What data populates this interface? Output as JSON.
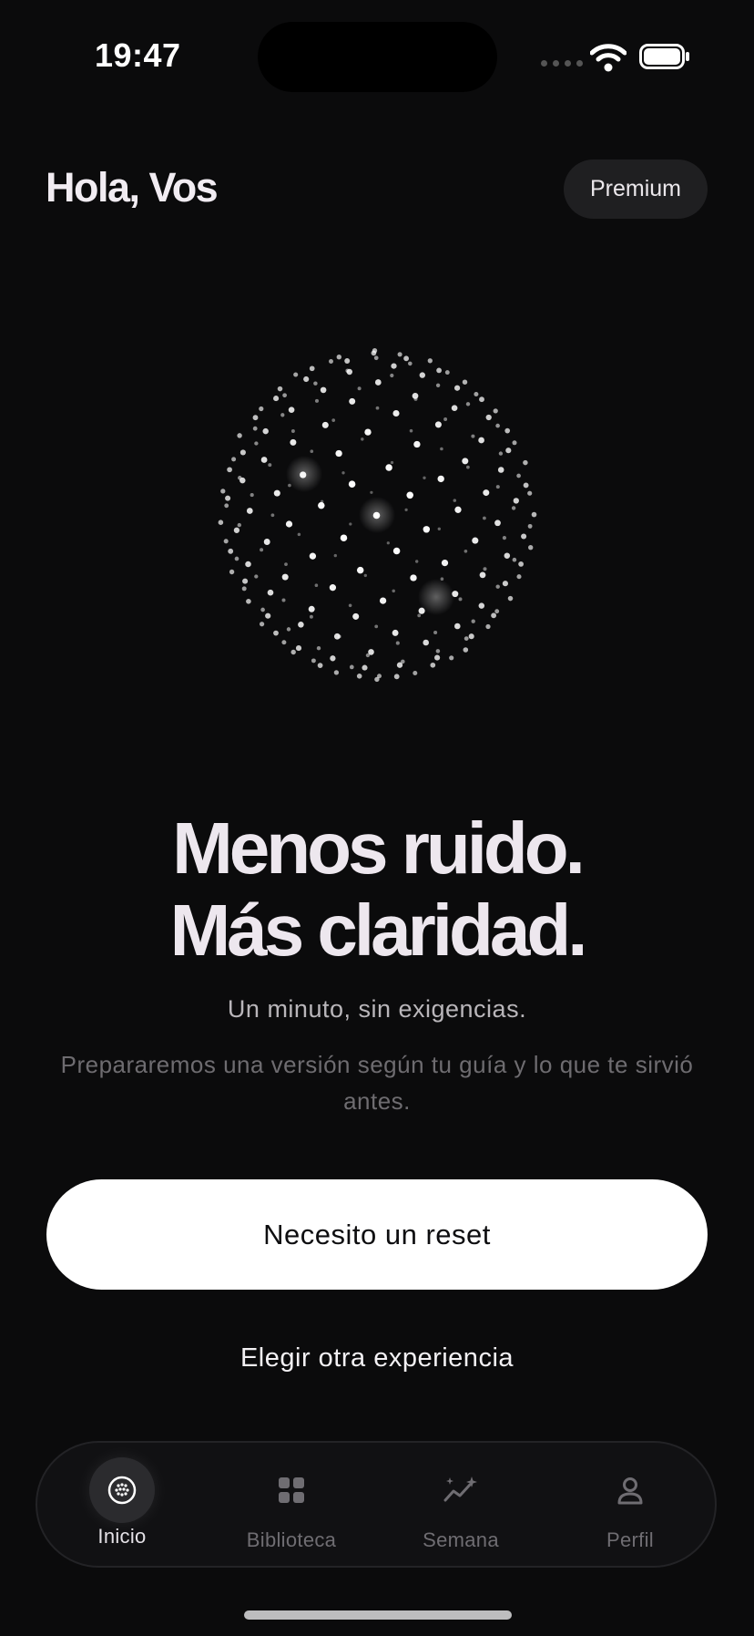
{
  "status_bar": {
    "time": "19:47"
  },
  "header": {
    "greeting": "Hola, Vos",
    "premium_label": "Premium"
  },
  "hero": {
    "headline_line1": "Menos ruido.",
    "headline_line2": "Más claridad.",
    "subtitle": "Un minuto, sin exigencias.",
    "description": "Prepararemos una versión según tu guía y lo que te sirvió antes."
  },
  "actions": {
    "primary_label": "Necesito un reset",
    "secondary_label": "Elegir otra experiencia"
  },
  "tabbar": {
    "items": [
      {
        "label": "Inicio",
        "icon": "home-orb-icon",
        "active": true
      },
      {
        "label": "Biblioteca",
        "icon": "grid-icon",
        "active": false
      },
      {
        "label": "Semana",
        "icon": "sparkle-chart-icon",
        "active": false
      },
      {
        "label": "Perfil",
        "icon": "person-icon",
        "active": false
      }
    ]
  },
  "colors": {
    "background": "#0b0b0c",
    "primary_button": "#ffffff",
    "muted_text": "#6e6c70"
  }
}
